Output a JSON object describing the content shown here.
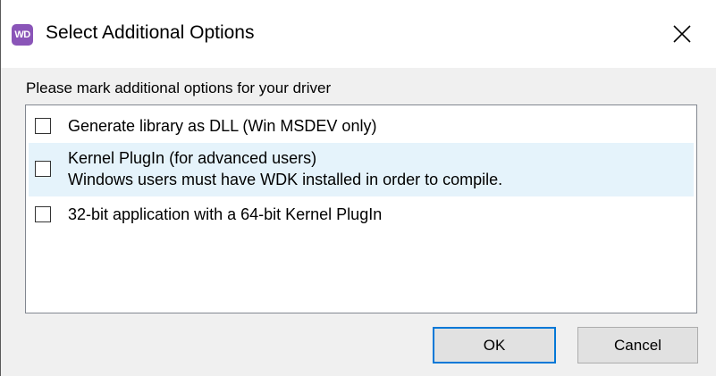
{
  "window": {
    "title": "Select Additional Options",
    "app_icon_text": "WD",
    "icons": {
      "app": "wd-app-icon",
      "close": "close-icon"
    },
    "accent_color": "#0078d7",
    "app_icon_color": "#8a55b8"
  },
  "prompt": "Please mark additional options for your driver",
  "options": [
    {
      "checked": false,
      "lines": [
        "Generate library as DLL (Win MSDEV only)"
      ]
    },
    {
      "checked": false,
      "highlighted": true,
      "lines": [
        "Kernel PlugIn (for advanced users)",
        "Windows users must have WDK installed in order to compile."
      ]
    },
    {
      "checked": false,
      "lines": [
        "32-bit application with a 64-bit Kernel PlugIn"
      ]
    }
  ],
  "buttons": {
    "ok_label": "OK",
    "cancel_label": "Cancel"
  }
}
